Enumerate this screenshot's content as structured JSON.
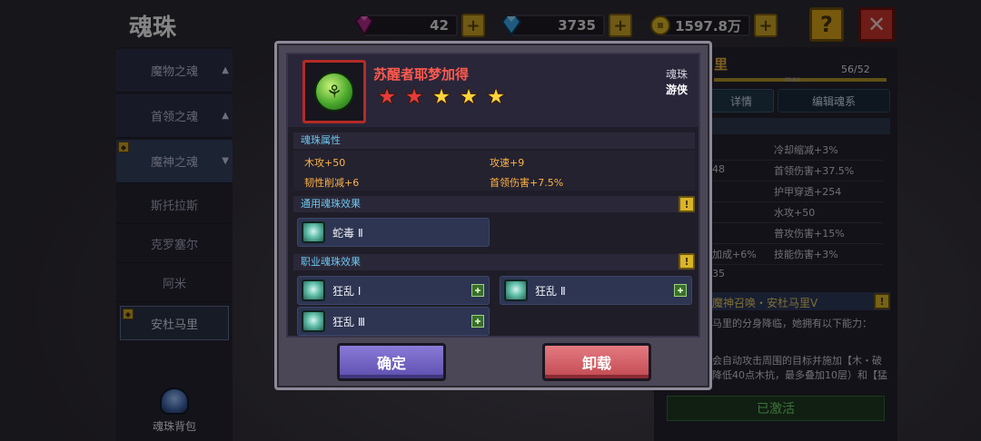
{
  "page": {
    "title": "魂珠"
  },
  "currencies": [
    {
      "icon": "purple-gem-icon",
      "value": "42",
      "color": "#b02a8a"
    },
    {
      "icon": "blue-diamond-icon",
      "value": "3735",
      "color": "#3aa6e8"
    },
    {
      "icon": "gold-coin-icon",
      "value": "1597.8万",
      "color": "#d8b429"
    }
  ],
  "sidebar": {
    "categories": [
      {
        "label": "魔物之魂",
        "arrow": "▲"
      },
      {
        "label": "首领之魂",
        "arrow": "▲"
      },
      {
        "label": "魔神之魂",
        "arrow": "▼"
      }
    ],
    "subitems": [
      "斯托拉斯",
      "克罗塞尔",
      "阿米",
      "安杜马里"
    ],
    "bag_label": "魂珠背包"
  },
  "right_panel": {
    "fragments": {
      "name_partial": "里",
      "count": "56/52",
      "max": "max",
      "tab1": "详情",
      "tab2": "编辑魂系",
      "s1": "冷却缩减+3%",
      "s2a": "48",
      "s2b": "首领伤害+37.5%",
      "s3": "护甲穿透+254",
      "s4": "水攻+50",
      "s5": "普攻伤害+15%",
      "s6a": "加成+6%",
      "s6b": "技能伤害+3%",
      "s7": "35",
      "summon": "魔神召唤・安杜马里Ⅴ",
      "desc1": "马里的分身降临，她拥有以下能力：",
      "desc2": "会自动攻击周围的目标并施加【木・破",
      "desc3": "降低40点木抗，最多叠加10层）和【猛",
      "activated": "已激活"
    }
  },
  "modal": {
    "soul_name": "苏醒者耶梦加得",
    "stars": [
      "red",
      "red",
      "gold",
      "gold",
      "gold"
    ],
    "type_label": "魂珠",
    "class_label": "游侠",
    "attr_title": "魂珠属性",
    "attrs": [
      "木攻+50",
      "攻速+9",
      "韧性削减+6",
      "首领伤害+7.5%"
    ],
    "common_title": "通用魂珠效果",
    "common_effects": [
      "蛇毒 Ⅱ"
    ],
    "job_title": "职业魂珠效果",
    "job_effects": [
      "狂乱 Ⅰ",
      "狂乱 Ⅱ",
      "狂乱 Ⅲ"
    ],
    "confirm_label": "确定",
    "unload_label": "卸载"
  }
}
